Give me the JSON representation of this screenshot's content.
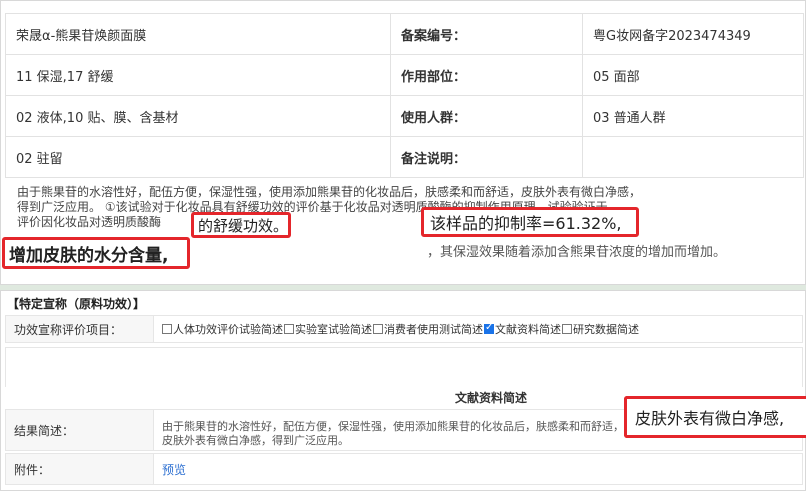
{
  "info": {
    "rows": [
      {
        "c1": "荣晟α-熊果苷焕颜面膜",
        "l2": "备案编号：",
        "c3": "粤G妆网备字2023474349"
      },
      {
        "c1": "11 保湿,17 舒缓",
        "l2": "作用部位：",
        "c3": "05 面部"
      },
      {
        "c1": "02 液体,10 贴、膜、含基材",
        "l2": "使用人群：",
        "c3": "03 普通人群"
      },
      {
        "c1": "02 驻留",
        "l2": "备注说明：",
        "c3": ""
      }
    ]
  },
  "description": {
    "lines": [
      "由于熊果苷的水溶性好，配伍方便，保湿性强，使用添加熊果苷的化妆品后，肤感柔和而舒适，皮肤外表有微白净感，",
      "得到广泛应用。 ①该试验对于化妆品具有舒缓功效的评价基于化妆品对透明质酸酶的抑制作用原理，试验验证于",
      "评价因化妆品对透明质酸酶",
      ""
    ],
    "highlight_1": "的舒缓功效。",
    "highlight_2": "该样品的抑制率=61.32%,",
    "highlight_3": "增加皮肤的水分含量,",
    "tail": "，其保湿效果随着添加含熊果苷浓度的增加而增加。"
  },
  "specific": {
    "section_title": "【特定宣称（原料功效）】",
    "type_label": "功效宣称评价项目：",
    "options": [
      {
        "label": "人体功效评价试验简述",
        "checked": false
      },
      {
        "label": "实验室试验简述",
        "checked": false
      },
      {
        "label": "消费者使用测试简述",
        "checked": false
      },
      {
        "label": "文献资料简述",
        "checked": true
      },
      {
        "label": "研究数据简述",
        "checked": false
      }
    ],
    "sub_title": "文献资料简述",
    "summary_label": "结果简述：",
    "summary_text": "由于熊果苷的水溶性好，配伍方便，保湿性强，使用添加熊果苷的化妆品后，肤感柔和而舒适，皮肤外表有微白净感，得到广泛应用。",
    "attach_label": "附件：",
    "attach_link": "预览",
    "highlight_4": "皮肤外表有微白净感,"
  },
  "colors": {
    "highlight": "#e4262b",
    "link": "#2c6fd1",
    "checked": "#1a73e8"
  }
}
